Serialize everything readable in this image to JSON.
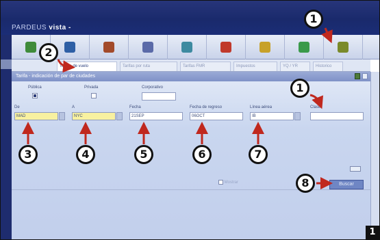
{
  "app": {
    "brand_prefix": "PARDEUS",
    "brand_name": "vista",
    "brand_suffix": "-"
  },
  "toolbar": {
    "icons": [
      "home-icon",
      "globe-icon",
      "currency-icon",
      "plane-icon",
      "monitor-icon",
      "user-icon",
      "key-icon",
      "folder-icon",
      "tools-icon"
    ],
    "colors": [
      "#3f8b3a",
      "#2e5fa5",
      "#a24a2a",
      "#5a6aa8",
      "#3d8aa0",
      "#c0392b",
      "#c7a12a",
      "#3a9a4a",
      "#7a8a2a"
    ]
  },
  "tabs": [
    {
      "label": "Tarifas de vuelo",
      "active": true
    },
    {
      "label": "Tarifas por ruta",
      "active": false
    },
    {
      "label": "Tarifas FMR",
      "active": false
    },
    {
      "label": "Impuestos",
      "active": false
    },
    {
      "label": "YQ / YR",
      "active": false
    },
    {
      "label": "Historico",
      "active": false
    }
  ],
  "panel": {
    "title": "Tarifa - indicación de par de ciudades"
  },
  "filters": {
    "publica": {
      "label": "Pública",
      "checked": true
    },
    "privada": {
      "label": "Privada",
      "checked": false
    },
    "corporativo": {
      "label": "Corporativo",
      "value": ""
    }
  },
  "fields": {
    "de": {
      "label": "De",
      "value": "MAD"
    },
    "a": {
      "label": "A",
      "value": "NYC"
    },
    "fecha": {
      "label": "Fecha",
      "value": "21SEP"
    },
    "fecha_regreso": {
      "label": "Fecha de regreso",
      "value": "06OCT"
    },
    "linea_aerea": {
      "label": "Línea aérea",
      "value": "IB"
    },
    "clase": {
      "label": "Clase",
      "value": ""
    }
  },
  "actions": {
    "search_label": "Buscar",
    "option_label": "Mostrar"
  },
  "callouts": {
    "toolbar": "1",
    "tabs": "2",
    "de": "3",
    "a": "4",
    "fecha": "5",
    "fecha_regreso": "6",
    "linea_aerea": "7",
    "search": "8",
    "clase": "1"
  },
  "page_number": "1"
}
